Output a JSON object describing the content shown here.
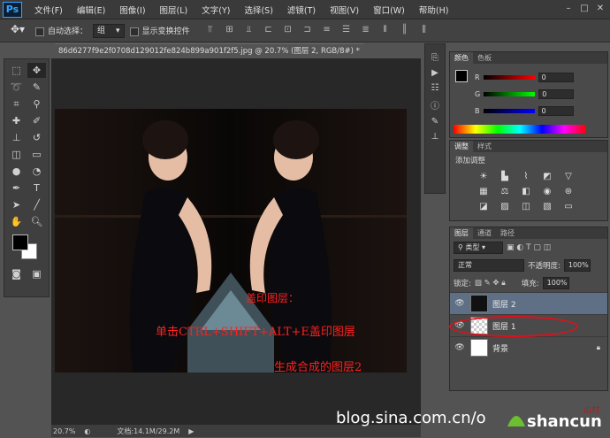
{
  "app": {
    "logo": "Ps"
  },
  "menu": [
    "文件(F)",
    "编辑(E)",
    "图像(I)",
    "图层(L)",
    "文字(Y)",
    "选择(S)",
    "滤镜(T)",
    "视图(V)",
    "窗口(W)",
    "帮助(H)"
  ],
  "options": {
    "auto_select_label": "自动选择：",
    "auto_select_value": "组",
    "show_transform_label": "显示变换控件"
  },
  "document": {
    "tab_title": "86d6277f9e2f0708d129012fe824b899a901f2f5.jpg @ 20.7% (图层 2, RGB/8#) *",
    "zoom": "20.7%",
    "doc_info": "文档:14.1M/29.2M"
  },
  "annotations": {
    "line1": "盖印图层：",
    "line2": "单击CTRL+SHIFT+ALT+E盖印图层",
    "line3": "生成合成的图层2"
  },
  "watermark": {
    "text": "blog.sina.com.cn/o",
    "logo_text": "shancun",
    "logo_sub": "山村"
  },
  "color_panel": {
    "tabs": [
      "颜色",
      "色板"
    ],
    "channels": [
      {
        "label": "R",
        "value": "0"
      },
      {
        "label": "G",
        "value": "0"
      },
      {
        "label": "B",
        "value": "0"
      }
    ]
  },
  "adjust_panel": {
    "tabs": [
      "调整",
      "样式"
    ],
    "heading": "添加调整"
  },
  "layers_panel": {
    "tabs": [
      "图层",
      "通道",
      "路径"
    ],
    "filter_label": "类型",
    "blend_mode": "正常",
    "opacity_label": "不透明度:",
    "opacity_value": "100%",
    "lock_label": "锁定:",
    "fill_label": "填充:",
    "fill_value": "100%",
    "layers": [
      {
        "name": "图层 2",
        "selected": true
      },
      {
        "name": "图层 1",
        "selected": false
      },
      {
        "name": "背景",
        "selected": false,
        "locked": true
      }
    ]
  },
  "colors": {
    "annotation": "#ff2020",
    "selection": "#5f6f85",
    "ellipse": "#e0101a"
  }
}
